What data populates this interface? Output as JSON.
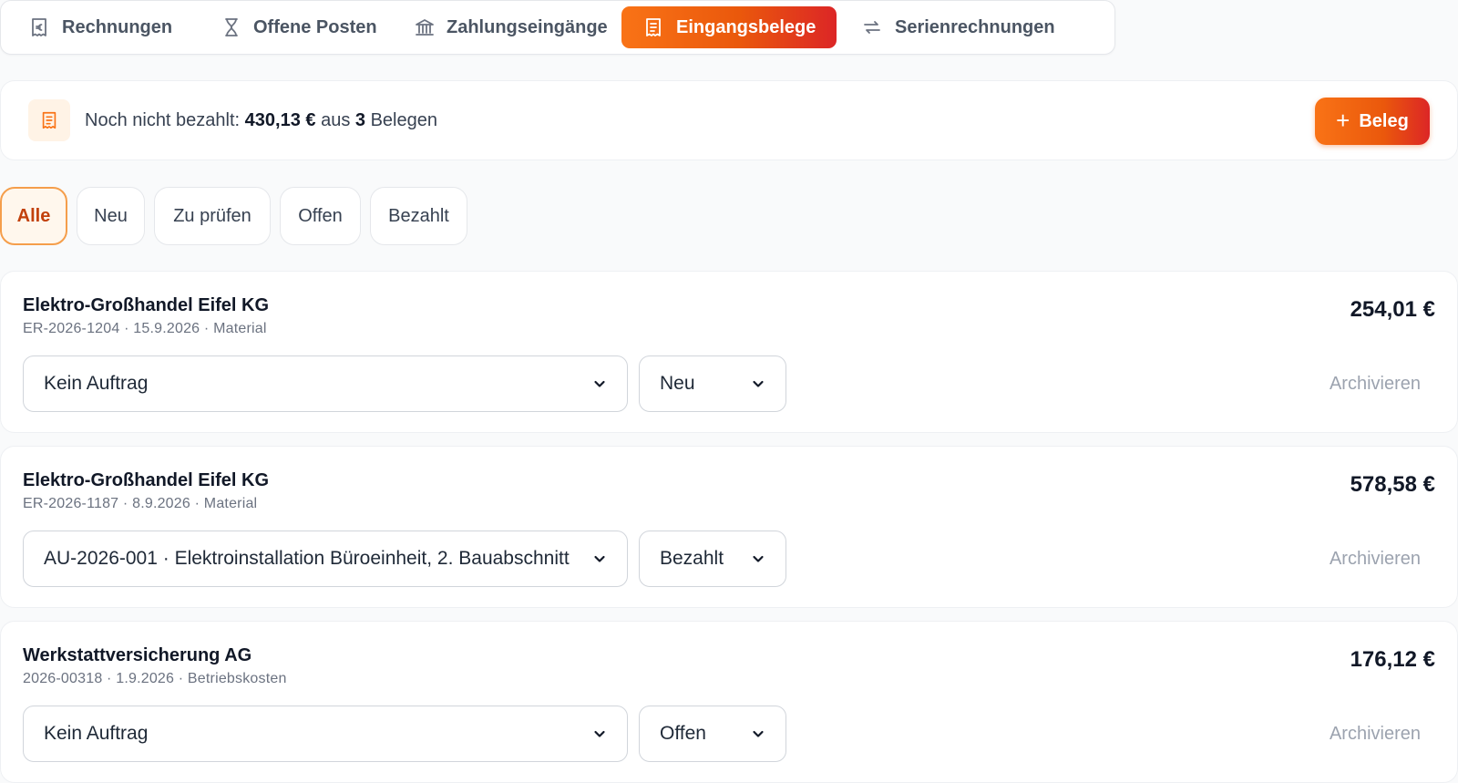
{
  "tabs": [
    {
      "label": "Rechnungen",
      "icon": "euro-receipt-icon",
      "active": false
    },
    {
      "label": "Offene Posten",
      "icon": "hourglass-icon",
      "active": false
    },
    {
      "label": "Zahlungseingänge",
      "icon": "bank-icon",
      "active": false
    },
    {
      "label": "Eingangsbelege",
      "icon": "receipt-icon",
      "active": true
    },
    {
      "label": "Serienrechnungen",
      "icon": "repeat-icon",
      "active": false
    }
  ],
  "summary": {
    "prefix": "Noch nicht bezahlt:",
    "amount": "430,13 €",
    "mid": "aus",
    "count": "3",
    "suffix": "Belegen",
    "icon": "receipt-icon",
    "add_button": {
      "plus": "+",
      "label": "Beleg"
    }
  },
  "filters": [
    {
      "label": "Alle",
      "active": true
    },
    {
      "label": "Neu",
      "active": false
    },
    {
      "label": "Zu prüfen",
      "active": false
    },
    {
      "label": "Offen",
      "active": false
    },
    {
      "label": "Bezahlt",
      "active": false
    }
  ],
  "receipts": [
    {
      "vendor": "Elektro-Großhandel Eifel KG",
      "meta": "ER-2026-1204 · 15.9.2026 · Material",
      "amount": "254,01 €",
      "order": "Kein Auftrag",
      "status": "Neu",
      "archive_label": "Archivieren"
    },
    {
      "vendor": "Elektro-Großhandel Eifel KG",
      "meta": "ER-2026-1187 · 8.9.2026 · Material",
      "amount": "578,58 €",
      "order": "AU-2026-001 · Elektroinstallation Büroeinheit, 2. Bauabschnitt",
      "status": "Bezahlt",
      "archive_label": "Archivieren"
    },
    {
      "vendor": "Werkstattversicherung AG",
      "meta": "2026-00318 · 1.9.2026 · Betriebskosten",
      "amount": "176,12 €",
      "order": "Kein Auftrag",
      "status": "Offen",
      "archive_label": "Archivieren"
    }
  ],
  "colors": {
    "accent": "#f97316",
    "accent_dark": "#dc2626",
    "chip_active_text": "#c2410c"
  }
}
